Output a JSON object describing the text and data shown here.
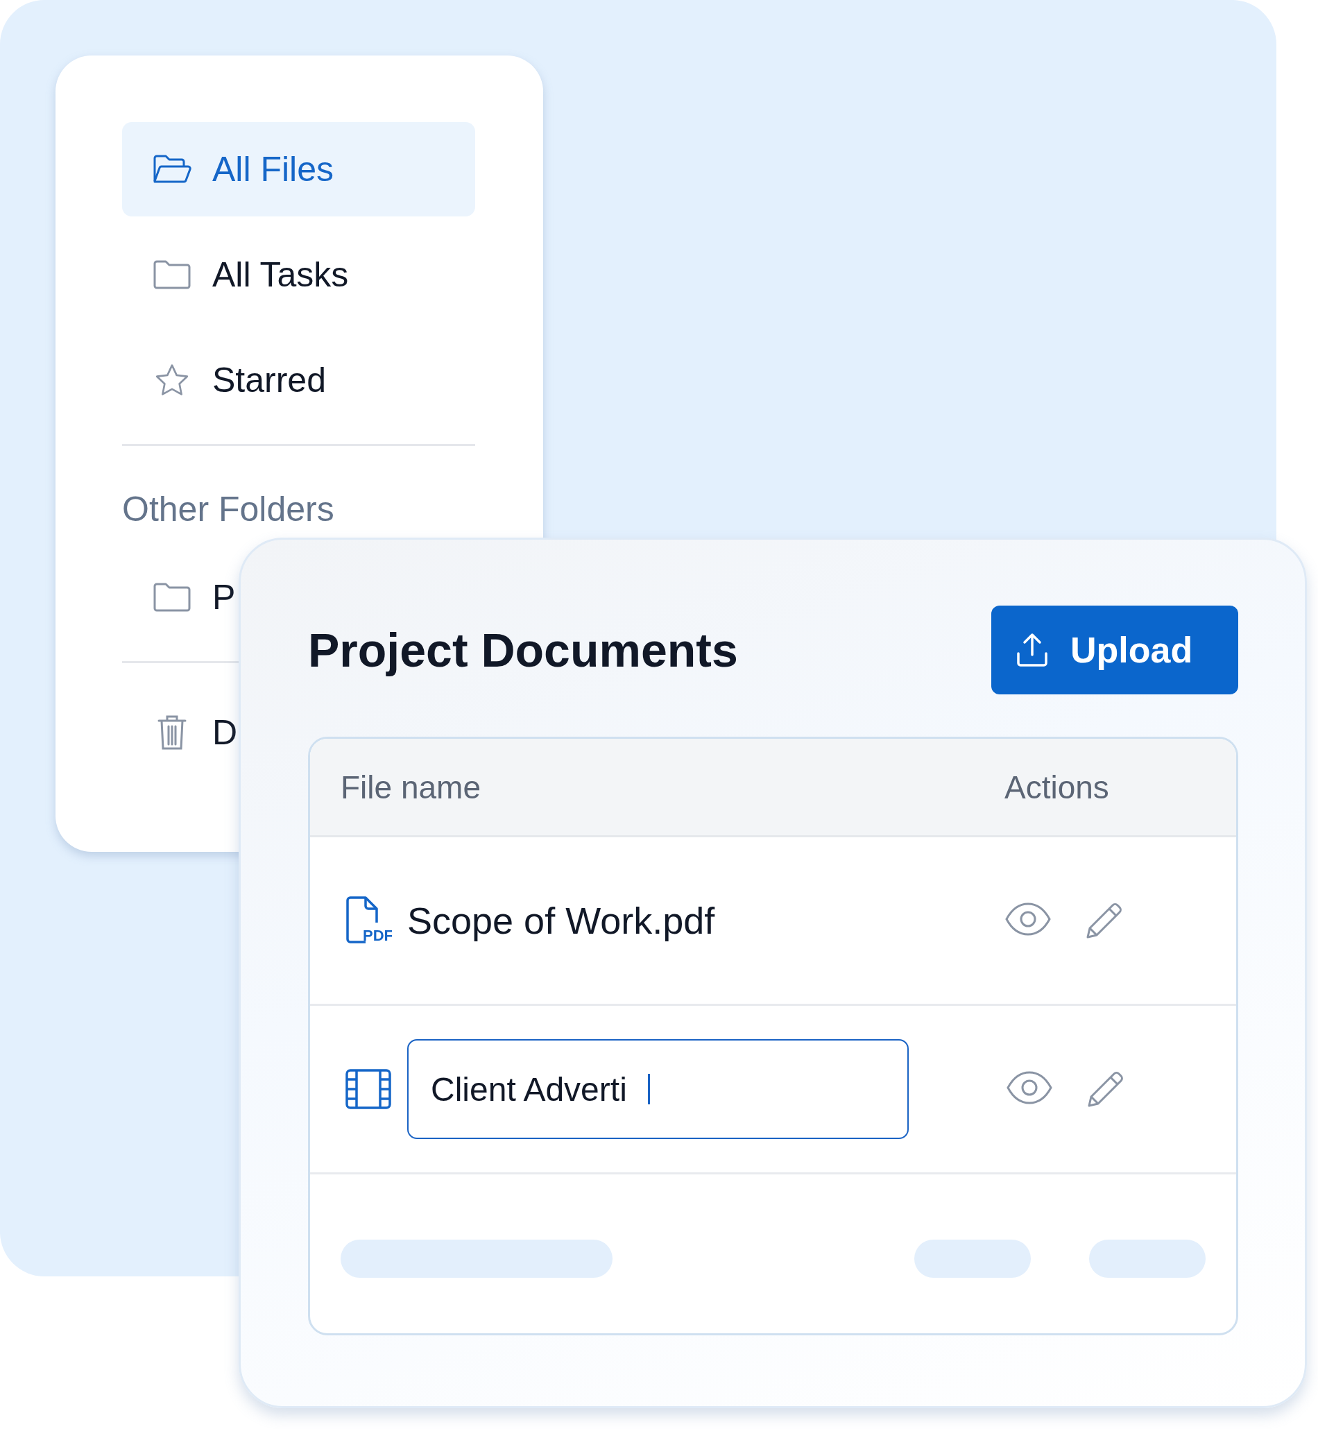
{
  "sidebar": {
    "items": [
      {
        "label": "All Files",
        "kind": "folder-open",
        "selected": true
      },
      {
        "label": "All Tasks",
        "kind": "folder",
        "selected": false
      },
      {
        "label": "Starred",
        "kind": "star",
        "selected": false
      }
    ],
    "section_title": "Other Folders",
    "folders": [
      {
        "label": "P",
        "kind": "folder",
        "selected": false
      }
    ],
    "bottom_items": [
      {
        "label": "D",
        "kind": "trash",
        "selected": false
      }
    ]
  },
  "panel": {
    "title": "Project Documents",
    "upload_button": "Upload",
    "table": {
      "columns": [
        "File name",
        "Actions"
      ],
      "rows": [
        {
          "kind": "pdf",
          "icon_label": "PDF",
          "name": "Scope of Work.pdf"
        },
        {
          "kind": "video-editing",
          "name": "Client Adverti"
        }
      ],
      "loading_row": [
        {
          "kind": "name"
        },
        {
          "kind": "action"
        },
        {
          "kind": "action"
        }
      ]
    }
  }
}
